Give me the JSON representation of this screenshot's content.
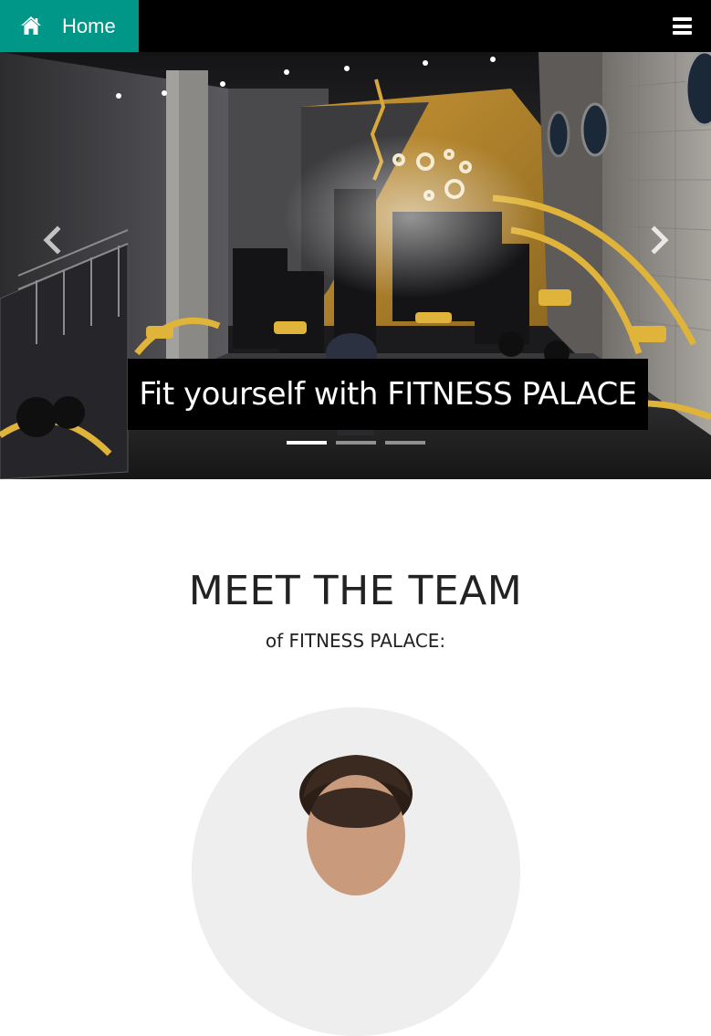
{
  "navbar": {
    "home_label": "Home",
    "home_icon": "home-icon",
    "menu_icon": "hamburger-menu-icon",
    "colors": {
      "bar": "#000000",
      "home_bg": "#009688",
      "text": "#ffffff"
    }
  },
  "hero": {
    "caption": "Fit yourself with FITNESS PALACE",
    "prev_icon": "chevron-left-icon",
    "next_icon": "chevron-right-icon",
    "slide_count": 3,
    "active_slide": 1,
    "image": "gym-interior-photo"
  },
  "team": {
    "heading": "MEET THE TEAM",
    "subheading": "of FITNESS PALACE:",
    "member_photo": "team-member-portrait"
  }
}
